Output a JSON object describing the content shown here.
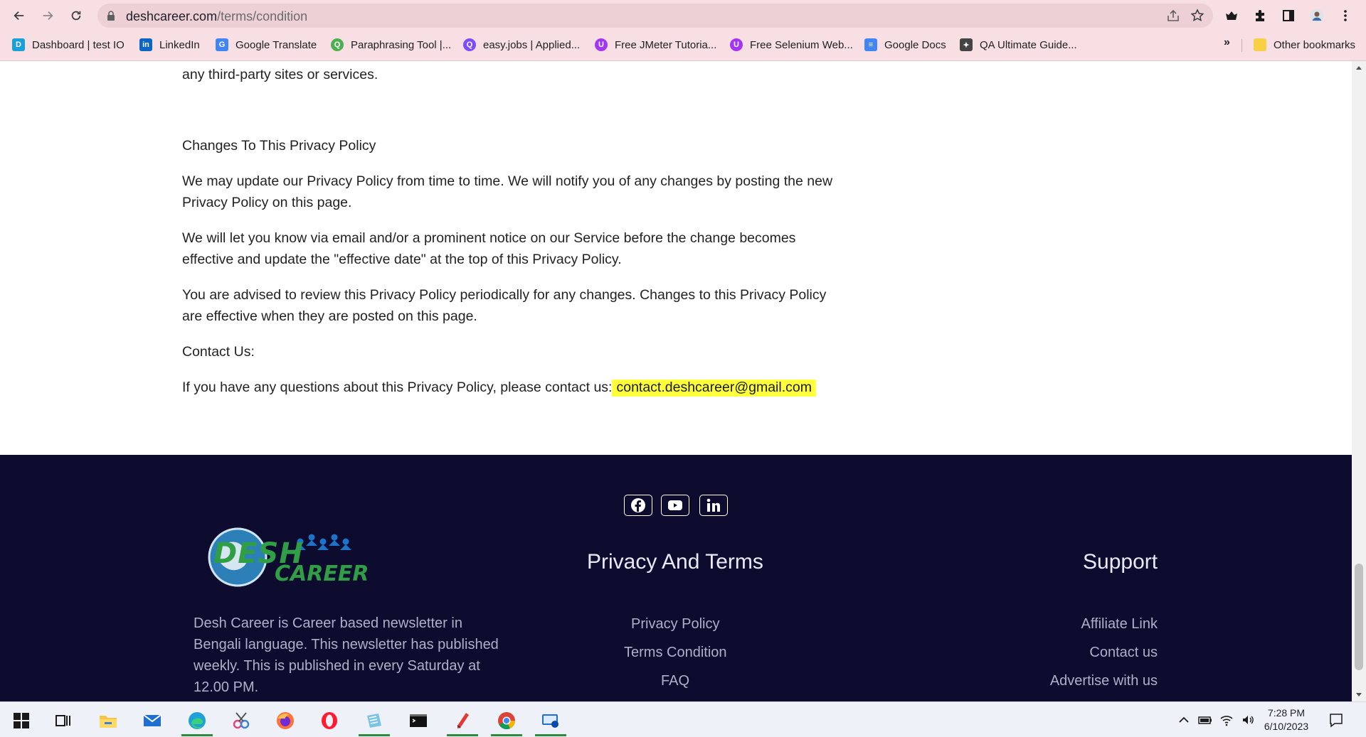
{
  "browser": {
    "url_domain": "deshcareer.com",
    "url_path": "/terms/condition",
    "bookmarks": [
      {
        "label": "Dashboard | test IO",
        "icon": "testio-icon",
        "color": "#1aa0d8"
      },
      {
        "label": "LinkedIn",
        "icon": "linkedin-icon",
        "color": "#0a66c2"
      },
      {
        "label": "Google Translate",
        "icon": "google-translate-icon",
        "color": "#4285f4"
      },
      {
        "label": "Paraphrasing Tool |...",
        "icon": "paraphrasing-icon",
        "color": "#4caf50"
      },
      {
        "label": "easy.jobs | Applied...",
        "icon": "easyjobs-icon",
        "color": "#7c4dff"
      },
      {
        "label": "Free JMeter Tutoria...",
        "icon": "udemy-icon",
        "color": "#a435f0"
      },
      {
        "label": "Free Selenium Web...",
        "icon": "udemy-icon",
        "color": "#a435f0"
      },
      {
        "label": "Google Docs",
        "icon": "google-docs-icon",
        "color": "#4285f4"
      },
      {
        "label": "QA Ultimate Guide...",
        "icon": "qa-guide-icon",
        "color": "#444444"
      }
    ],
    "bookmarks_more": "»",
    "other_bookmarks": "Other bookmarks"
  },
  "content": {
    "intro_tail": "any third-party sites or services.",
    "heading": "Changes To This Privacy Policy",
    "para1": "We may update our Privacy Policy from time to time. We will notify you of any changes by posting the new Privacy Policy on this page.",
    "para2": "We will let you know via email and/or a prominent notice on our Service before the change becomes effective and update the \"effective date\" at the top of this Privacy Policy.",
    "para3": "You are advised to review this Privacy Policy periodically for any changes. Changes to this Privacy Policy are effective when they are posted on this page.",
    "contact_label": "Contact Us:",
    "contact_text": "If you have any questions about this Privacy Policy, please contact us:",
    "email": "contact.deshcareer@gmail.com",
    "highlight_color": "#ffff3b"
  },
  "footer": {
    "background": "#0d0c2f",
    "social": [
      "facebook-icon",
      "youtube-icon",
      "linkedin-icon"
    ],
    "logo_text_top": "DESH",
    "logo_text_bottom": "CAREER",
    "about": "Desh Career is Career based newsletter in Bengali language. This newsletter has published weekly. This is published in every Saturday at 12.00 PM.",
    "privacy_heading": "Privacy And Terms",
    "privacy_links": [
      "Privacy Policy",
      "Terms Condition",
      "FAQ"
    ],
    "support_heading": "Support",
    "support_links": [
      "Affiliate Link",
      "Contact us",
      "Advertise with us"
    ]
  },
  "taskbar": {
    "apps": [
      "windows-start-icon",
      "task-view-icon",
      "file-explorer-icon",
      "mail-icon",
      "edge-icon",
      "snipping-tool-icon",
      "firefox-icon",
      "opera-icon",
      "notepad-icon",
      "terminal-icon",
      "paint-pen-icon",
      "chrome-icon",
      "remote-desktop-icon"
    ],
    "time": "7:28 PM",
    "date": "6/10/2023"
  }
}
